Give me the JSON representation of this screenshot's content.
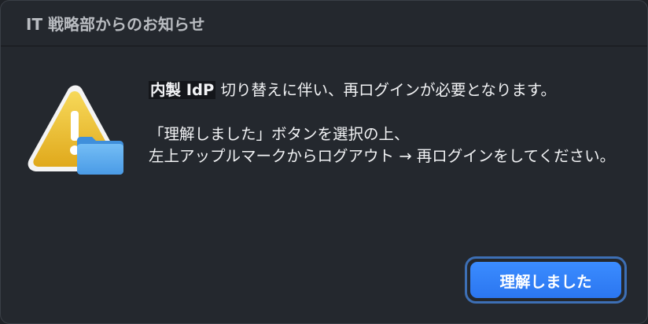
{
  "dialog": {
    "title": "IT 戦略部からのお知らせ",
    "message": {
      "line1_highlight": "内製 IdP",
      "line1_rest": " 切り替えに伴い、再ログインが必要となります。",
      "line2": "「理解しました」ボタンを選択の上、",
      "line3": "左上アップルマークからログアウト → 再ログインをしてください。"
    },
    "icons": {
      "warning": "warning-triangle-icon",
      "folder": "folder-icon"
    },
    "button": {
      "label": "理解しました"
    }
  },
  "colors": {
    "accent": "#2f7df5",
    "warning": "#f2c230",
    "folder": "#5aa9ec"
  }
}
